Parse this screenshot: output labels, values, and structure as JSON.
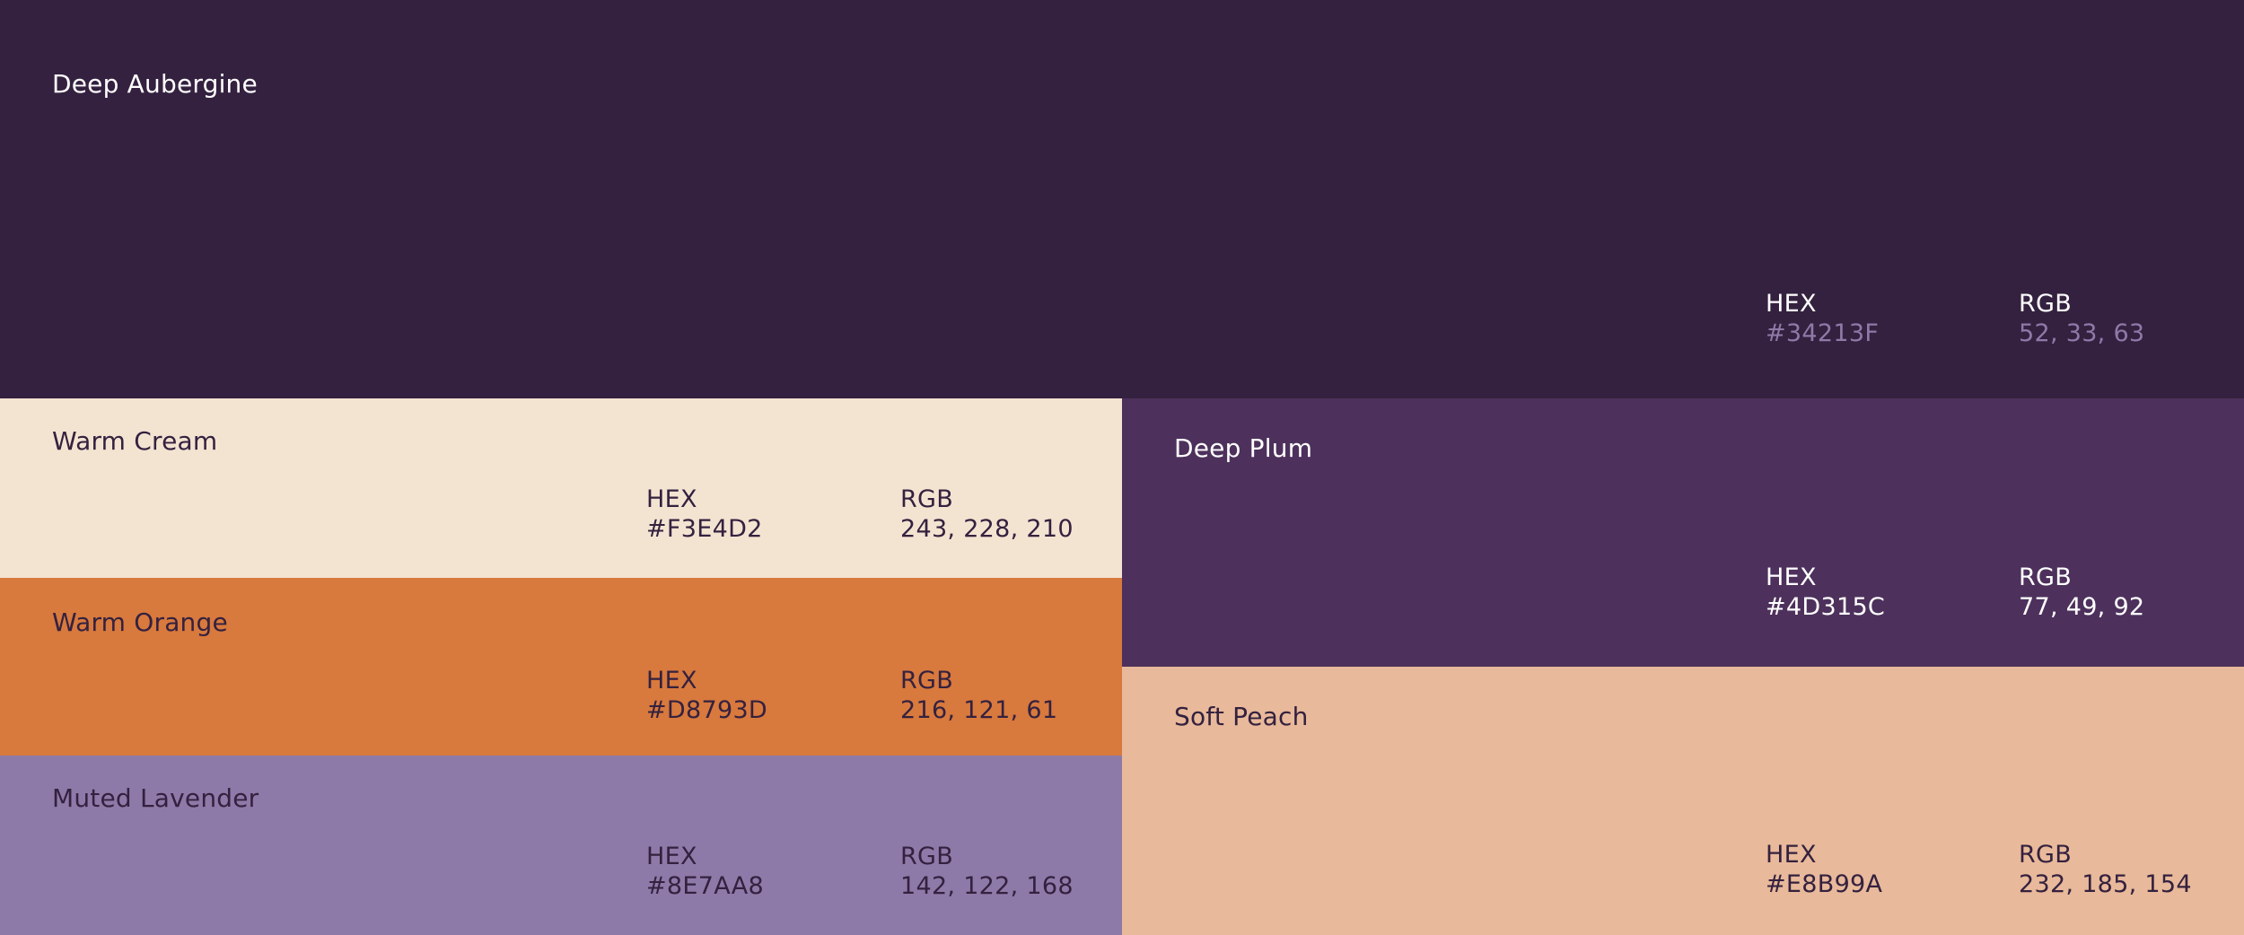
{
  "swatches": {
    "aubergine": {
      "name": "Deep Aubergine",
      "hex_label": "HEX",
      "hex": "#34213F",
      "rgb_label": "RGB",
      "rgb": "52, 33, 63",
      "color": "#34213F"
    },
    "cream": {
      "name": "Warm Cream",
      "hex_label": "HEX",
      "hex": "#F3E4D2",
      "rgb_label": "RGB",
      "rgb": "243, 228, 210",
      "color": "#F3E4D2"
    },
    "orange": {
      "name": "Warm Orange",
      "hex_label": "HEX",
      "hex": "#D8793D",
      "rgb_label": "RGB",
      "rgb": "216, 121, 61",
      "color": "#D8793D"
    },
    "lavender": {
      "name": "Muted Lavender",
      "hex_label": "HEX",
      "hex": "#8E7AA8",
      "rgb_label": "RGB",
      "rgb": "142, 122, 168",
      "color": "#8E7AA8"
    },
    "plum": {
      "name": "Deep Plum",
      "hex_label": "HEX",
      "hex": "#4D315C",
      "rgb_label": "RGB",
      "rgb": "77, 49, 92",
      "color": "#4D315C"
    },
    "peach": {
      "name": "Soft Peach",
      "hex_label": "HEX",
      "hex": "#E8B99A",
      "rgb_label": "RGB",
      "rgb": "232, 185, 154",
      "color": "#E8B99A"
    }
  }
}
